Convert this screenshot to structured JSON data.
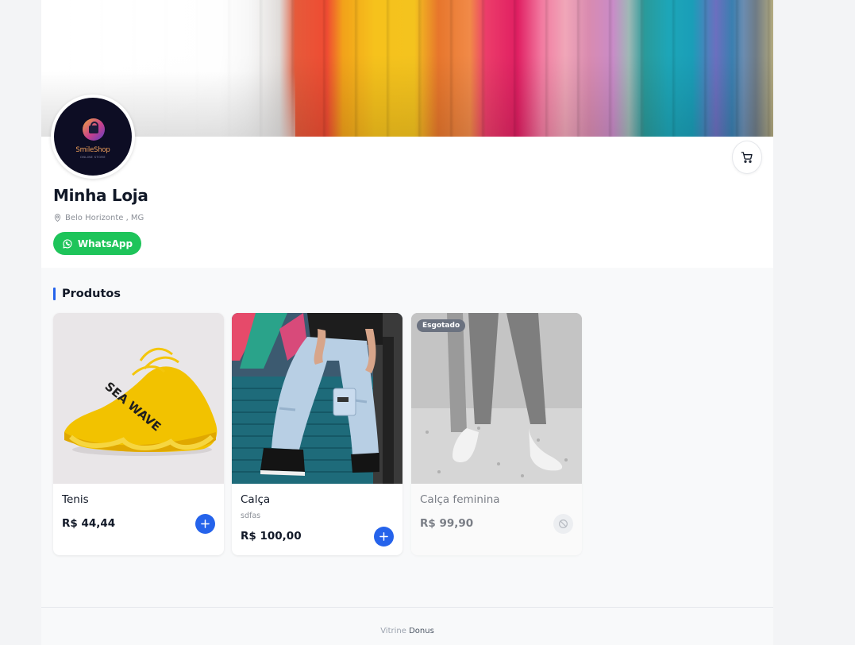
{
  "store": {
    "name": "Minha Loja",
    "location": "Belo Horizonte , MG",
    "whatsapp_label": "WhatsApp",
    "logo": {
      "text": "SmileShop",
      "subtext": "ONLINE STORE"
    }
  },
  "products_section": {
    "title": "Produtos"
  },
  "products": [
    {
      "name": "Tenis",
      "description": "",
      "price": "R$ 44,44",
      "sold_out": false
    },
    {
      "name": "Calça",
      "description": "sdfas",
      "price": "R$ 100,00",
      "sold_out": false
    },
    {
      "name": "Calça feminina",
      "description": "",
      "price": "R$ 99,90",
      "sold_out": true,
      "badge": "Esgotado"
    }
  ],
  "footer": {
    "prefix": "Vitrine",
    "brand": "Donus"
  },
  "icons": {
    "cart": "cart-icon",
    "location": "map-pin-icon",
    "whatsapp": "whatsapp-icon",
    "add": "plus-icon",
    "unavailable": "ban-icon"
  },
  "colors": {
    "accent": "#2563eb",
    "whatsapp": "#1ec45a",
    "badge": "#6b7280"
  }
}
